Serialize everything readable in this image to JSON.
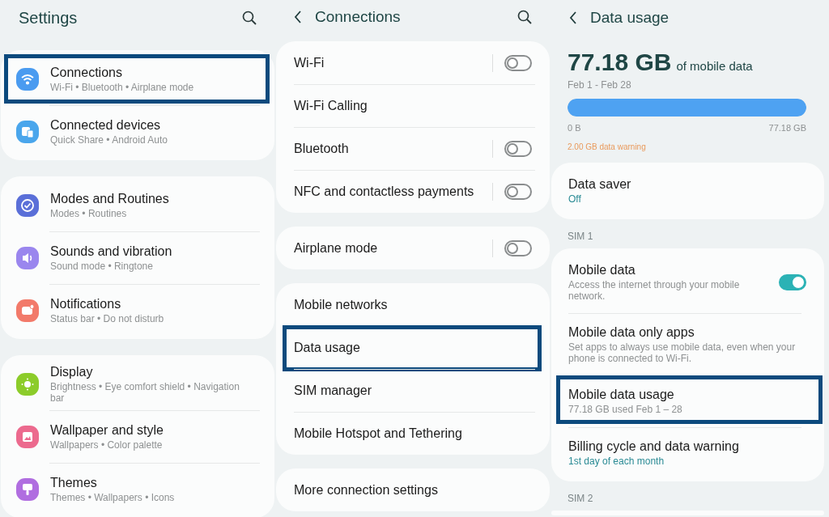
{
  "panels": [
    {
      "kind": "settings",
      "title": "Settings",
      "back": false,
      "search": true,
      "groups": [
        {
          "items": [
            {
              "title": "Connections",
              "subtitle": "Wi-Fi • Bluetooth • Airplane mode",
              "color": "#4a9bf0",
              "highlighted": true
            },
            {
              "title": "Connected devices",
              "subtitle": "Quick Share • Android Auto",
              "color": "#4aa6ec",
              "highlighted": false
            }
          ]
        },
        {
          "items": [
            {
              "title": "Modes and Routines",
              "subtitle": "Modes • Routines",
              "color": "#5a6fd8",
              "highlighted": false
            },
            {
              "title": "Sounds and vibration",
              "subtitle": "Sound mode • Ringtone",
              "color": "#9a86ee",
              "highlighted": false
            },
            {
              "title": "Notifications",
              "subtitle": "Status bar • Do not disturb",
              "color": "#f27a6a",
              "highlighted": false
            }
          ]
        },
        {
          "items": [
            {
              "title": "Display",
              "subtitle": "Brightness • Eye comfort shield • Navigation bar",
              "color": "#8ccc2a",
              "highlighted": false
            },
            {
              "title": "Wallpaper and style",
              "subtitle": "Wallpapers • Color palette",
              "color": "#ec6a8e",
              "highlighted": false
            },
            {
              "title": "Themes",
              "subtitle": "Themes • Wallpapers • Icons",
              "color": "#b06ee0",
              "highlighted": false
            }
          ]
        }
      ]
    },
    {
      "kind": "list",
      "title": "Connections",
      "back": true,
      "search": true,
      "groups": [
        {
          "items": [
            {
              "title": "Wi-Fi",
              "switch": {
                "on": false,
                "separated": true
              },
              "highlighted": false
            },
            {
              "title": "Wi-Fi Calling",
              "highlighted": false
            },
            {
              "title": "Bluetooth",
              "switch": {
                "on": false,
                "separated": true
              },
              "highlighted": false
            },
            {
              "title": "NFC and contactless payments",
              "switch": {
                "on": false,
                "separated": true
              },
              "highlighted": false
            }
          ]
        },
        {
          "items": [
            {
              "title": "Airplane mode",
              "switch": {
                "on": false,
                "separated": true
              },
              "highlighted": false
            }
          ]
        },
        {
          "items": [
            {
              "title": "Mobile networks",
              "highlighted": false
            },
            {
              "title": "Data usage",
              "highlighted": true
            },
            {
              "title": "SIM manager",
              "highlighted": false
            },
            {
              "title": "Mobile Hotspot and Tethering",
              "highlighted": false
            }
          ]
        },
        {
          "items": [
            {
              "title": "More connection settings",
              "highlighted": false
            }
          ]
        }
      ]
    },
    {
      "kind": "usage",
      "title": "Data usage",
      "back": true,
      "search": false,
      "summary": {
        "amount": "77.18 GB",
        "amount_note": "of mobile data",
        "period": "Feb 1 - Feb 28",
        "level": 1,
        "min_label": "0 B",
        "max_label": "77.18 GB",
        "warning": "2.00 GB data warning"
      },
      "groups": [
        {
          "items": [
            {
              "title": "Data saver",
              "subtitle": "Off",
              "accent": true,
              "highlighted": false
            }
          ]
        },
        {
          "label": "SIM 1",
          "items": [
            {
              "title": "Mobile data",
              "subtitle": "Access the internet through your mobile network.",
              "switch": {
                "on": true,
                "separated": false
              },
              "highlighted": false
            },
            {
              "title": "Mobile data only apps",
              "subtitle": "Set apps to always use mobile data, even when your phone is connected to Wi-Fi.",
              "highlighted": false
            },
            {
              "title": "Mobile data usage",
              "subtitle": "77.18 GB used Feb 1 – 28",
              "highlighted": true
            },
            {
              "title": "Billing cycle and data warning",
              "subtitle": "1st day of each month",
              "accent": true,
              "highlighted": false
            }
          ]
        },
        {
          "label": "SIM 2"
        }
      ]
    }
  ]
}
